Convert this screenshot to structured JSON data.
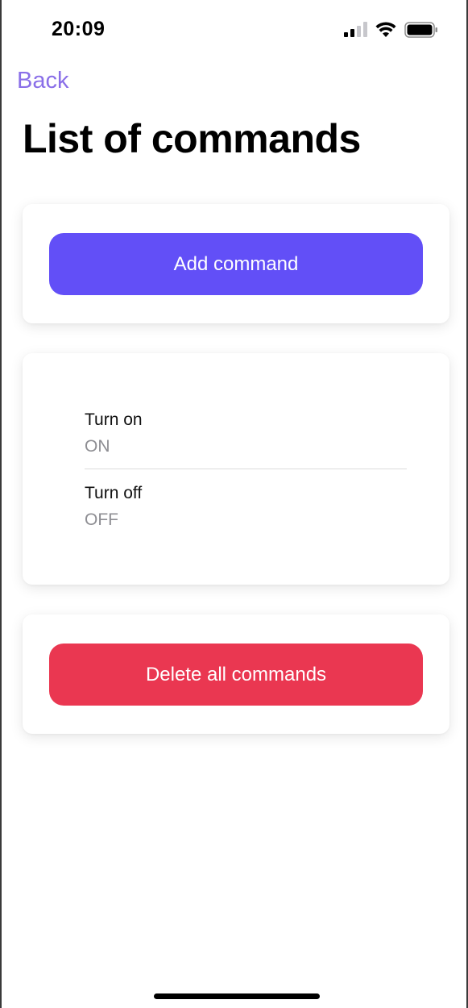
{
  "status_bar": {
    "time": "20:09",
    "icons": [
      "cellular-signal-icon",
      "wifi-icon",
      "battery-icon"
    ]
  },
  "nav": {
    "back_label": "Back"
  },
  "page": {
    "title": "List of commands"
  },
  "actions": {
    "add_label": "Add command",
    "delete_label": "Delete all commands"
  },
  "commands": [
    {
      "name": "Turn on",
      "code": "ON"
    },
    {
      "name": "Turn off",
      "code": "OFF"
    }
  ],
  "colors": {
    "accent": "#624ff7",
    "back_link": "#8a6fe8",
    "danger": "#ea3751",
    "secondary_text": "#8e8e93"
  }
}
